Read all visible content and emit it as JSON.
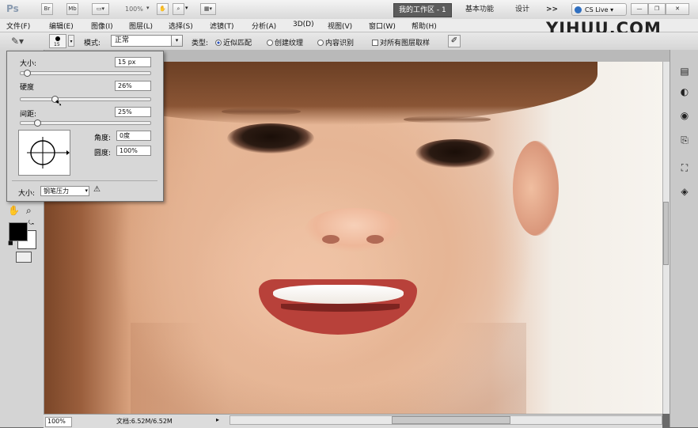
{
  "titlebar": {
    "app_logo": "Ps",
    "zoom": "100%",
    "workspaces": [
      "我的工作区 - 1",
      "基本功能",
      "设计"
    ],
    "more": ">>",
    "cslive": "CS Live"
  },
  "menu": [
    "文件(F)",
    "编辑(E)",
    "图像(I)",
    "图层(L)",
    "选择(S)",
    "滤镜(T)",
    "分析(A)",
    "3D(D)",
    "视图(V)",
    "窗口(W)",
    "帮助(H)"
  ],
  "watermark": "YIHUU.COM",
  "options": {
    "brush_size_number": "15",
    "mode_label": "模式:",
    "mode_value": "正常",
    "type_label": "类型:",
    "type_options": [
      "近似匹配",
      "创建纹理",
      "内容识别"
    ],
    "sample_all_label": "对所有图层取样"
  },
  "brush_popup": {
    "size_label": "大小:",
    "size_value": "15 px",
    "hardness_label": "硬度",
    "hardness_value": "26%",
    "spacing_label": "间距:",
    "spacing_value": "25%",
    "angle_label": "角度:",
    "angle_value": "0度",
    "roundness_label": "圆度:",
    "roundness_value": "100%",
    "size_ctrl_label": "大小:",
    "size_ctrl_value": "钢笔压力",
    "sliders": {
      "size": 0.05,
      "hardness": 0.26,
      "spacing": 0.13
    }
  },
  "status": {
    "zoom": "100%",
    "doc_info": "文档:6.52M/6.52M"
  },
  "icons": [
    "photoshop-logo",
    "bridge-icon",
    "minibridge-icon",
    "layout-icon",
    "hand-icon",
    "zoom-icon",
    "arrange-icon",
    "cslive-icon",
    "minimize-icon",
    "restore-icon",
    "close-icon",
    "healing-brush-icon",
    "brush-preset-icon",
    "clone-icon",
    "warning-icon",
    "hand-tool-icon",
    "zoom-tool-icon",
    "screen-mode-icon"
  ]
}
